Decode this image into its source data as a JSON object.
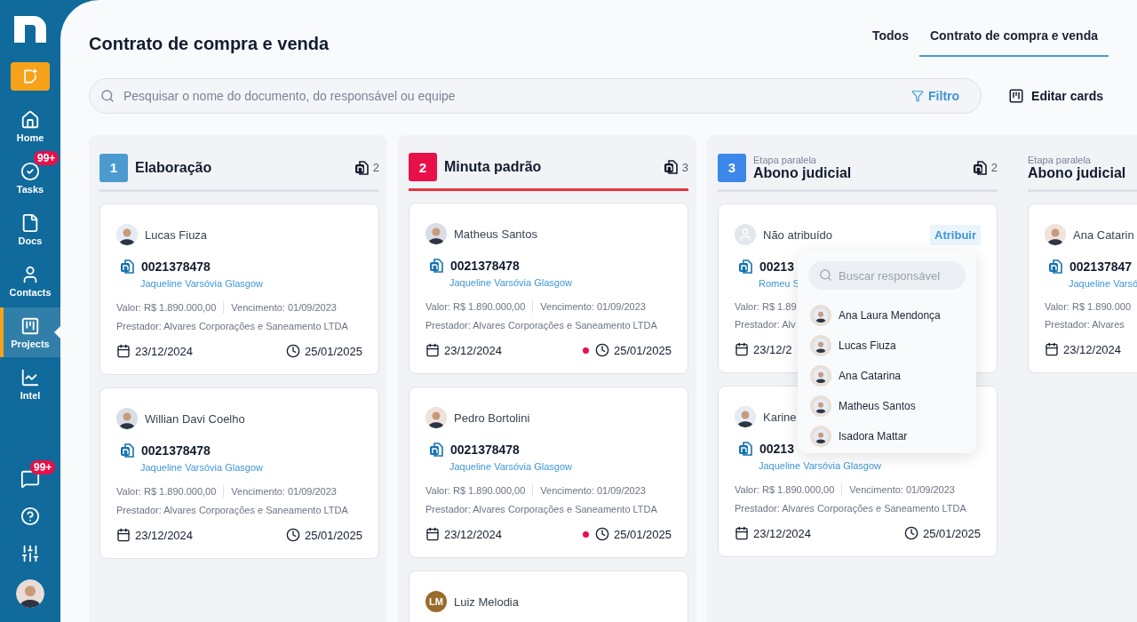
{
  "sidebar": {
    "items": [
      {
        "label": "Home",
        "selected": false
      },
      {
        "label": "Tasks",
        "selected": false,
        "badge": "99+"
      },
      {
        "label": "Docs",
        "selected": false
      },
      {
        "label": "Contacts",
        "selected": false
      },
      {
        "label": "Projects",
        "selected": true
      },
      {
        "label": "Intel",
        "selected": false
      }
    ],
    "chat_badge": "99+"
  },
  "page": {
    "title": "Contrato de compra e venda"
  },
  "tabs": [
    {
      "label": "Todos",
      "selected": false
    },
    {
      "label": "Contrato de compra e venda",
      "selected": true
    }
  ],
  "search": {
    "placeholder": "Pesquisar o nome do documento, do responsável ou equipe",
    "filter": "Filtro"
  },
  "edit_cards": "Editar cards",
  "columns": [
    {
      "kind": "stage",
      "stages": [
        {
          "number": "1",
          "color": "#4b9bd1",
          "highlighted": false,
          "title": "Elaboração",
          "count": "2",
          "cards": [
            {
              "kind": "photo",
              "person": "Lucas Fiuza",
              "number": "0021378478",
              "client": "Jaqueline Varsóvia Glasgow",
              "valor": "Valor: R$ 1.890.000,00",
              "vencimento": "Vencimento: 01/09/2023",
              "prestador": "Prestador: Alvares Corporações e Saneamento LTDA",
              "start": "23/12/2024",
              "due": "25/01/2025",
              "overdue": false
            },
            {
              "kind": "photo",
              "person": "Willian Davi Coelho",
              "number": "0021378478",
              "client": "Jaqueline Varsóvia Glasgow",
              "valor": "Valor: R$ 1.890.000,00",
              "vencimento": "Vencimento: 01/09/2023",
              "prestador": "Prestador: Alvares Corporações e Saneamento LTDA",
              "start": "23/12/2024",
              "due": "25/01/2025",
              "overdue": false
            }
          ]
        }
      ]
    },
    {
      "kind": "stage",
      "stages": [
        {
          "number": "2",
          "color": "#e8104a",
          "highlighted": true,
          "title": "Minuta padrão",
          "count": "3",
          "cards": [
            {
              "kind": "photo",
              "person": "Matheus Santos",
              "number": "0021378478",
              "client": "Jaqueline Varsóvia Glasgow",
              "valor": "Valor: R$ 1.890.000,00",
              "vencimento": "Vencimento: 01/09/2023",
              "prestador": "Prestador: Alvares Corporações e Saneamento LTDA",
              "start": "23/12/2024",
              "due": "25/01/2025",
              "overdue": true
            },
            {
              "kind": "photo",
              "person": "Pedro Bortolini",
              "number": "0021378478",
              "client": "Jaqueline Varsóvia Glasgow",
              "valor": "Valor: R$ 1.890.000,00",
              "vencimento": "Vencimento: 01/09/2023",
              "prestador": "Prestador: Alvares Corporações e Saneamento LTDA",
              "start": "23/12/2024",
              "due": "25/01/2025",
              "overdue": true
            },
            {
              "kind": "initials",
              "initials": "LM",
              "person": "Luiz Melodia"
            }
          ]
        }
      ]
    },
    {
      "kind": "parallel",
      "stages": [
        {
          "number": "3",
          "color": "#3d86ea",
          "highlighted": false,
          "caption": "Etapa paralela",
          "title": "Abono judicial",
          "count": "2",
          "cards": [
            {
              "kind": "empty",
              "person": "Não atribuído",
              "assign": "Atribuir",
              "number": "00213",
              "client": "Romeu S",
              "valor": "Valor: R$ 1.89",
              "prestador": "Prestador: Alv",
              "start": "23/12/2"
            },
            {
              "kind": "photo",
              "person": "Karine",
              "number": "00213",
              "client": "Jaqueline Varsóvia Glasgow",
              "valor": "Valor: R$ 1.890.000,00",
              "vencimento": "Vencimento: 01/09/2023",
              "prestador": "Prestador: Alvares Corporações e Saneamento LTDA",
              "start": "23/12/2024",
              "due": "25/01/2025",
              "overdue": false
            }
          ]
        },
        {
          "caption": "Etapa paralela",
          "title": "Abono judicial",
          "cards": [
            {
              "kind": "photo",
              "person": "Ana Catarin",
              "number": "002137847",
              "client": "Jaqueline Varsó",
              "valor": "Valor: R$ 1.890.000",
              "prestador": "Prestador: Alvares",
              "start": "23/12/2024"
            }
          ]
        }
      ]
    }
  ],
  "assign_menu": {
    "placeholder": "Buscar responsável",
    "people": [
      "Ana Laura Mendonça",
      "Lucas Fiuza",
      "Ana Catarina",
      "Matheus Santos",
      "Isadora Mattar"
    ]
  }
}
